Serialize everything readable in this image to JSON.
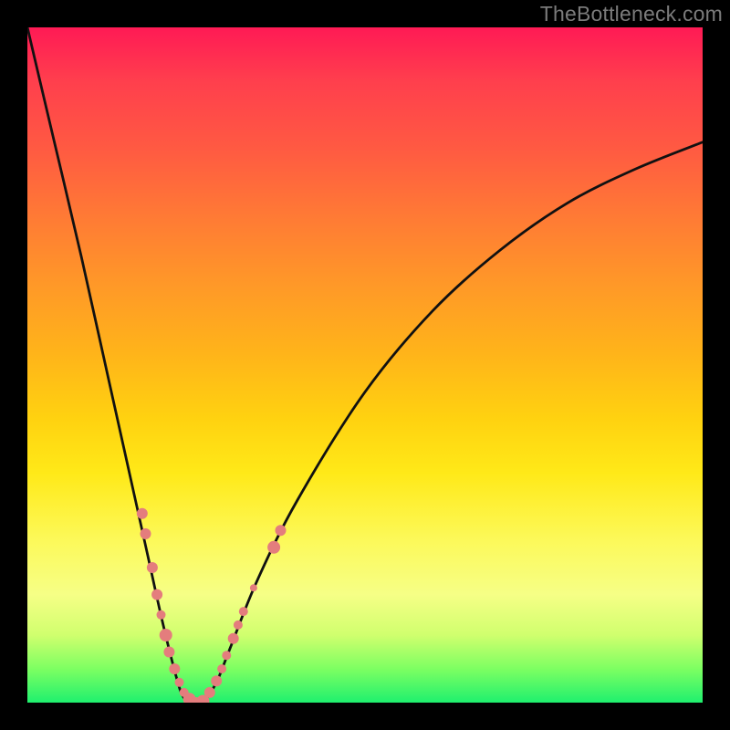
{
  "watermark": "TheBottleneck.com",
  "colors": {
    "background": "#000000",
    "gradient_top": "#ff1a55",
    "gradient_bottom": "#1ff06e",
    "curve": "#111111",
    "markers": "#e47d7d"
  },
  "chart_data": {
    "type": "line",
    "title": "",
    "xlabel": "",
    "ylabel": "",
    "xlim": [
      0,
      100
    ],
    "ylim": [
      0,
      100
    ],
    "series": [
      {
        "name": "curve",
        "x": [
          0,
          4,
          8,
          12,
          16,
          18,
          20,
          22,
          23,
          24,
          25,
          26,
          28,
          30,
          34,
          40,
          50,
          60,
          70,
          80,
          90,
          100
        ],
        "y": [
          100,
          83,
          66,
          48,
          30,
          21,
          12,
          4,
          1,
          0,
          0,
          0,
          3,
          8,
          18,
          30,
          46,
          58,
          67,
          74,
          79,
          83
        ]
      }
    ],
    "markers": [
      {
        "x": 17.0,
        "y": 28.0,
        "size": 12
      },
      {
        "x": 17.5,
        "y": 25.0,
        "size": 12
      },
      {
        "x": 18.5,
        "y": 20.0,
        "size": 12
      },
      {
        "x": 19.2,
        "y": 16.0,
        "size": 12
      },
      {
        "x": 19.8,
        "y": 13.0,
        "size": 10
      },
      {
        "x": 20.5,
        "y": 10.0,
        "size": 14
      },
      {
        "x": 21.0,
        "y": 7.5,
        "size": 12
      },
      {
        "x": 21.8,
        "y": 5.0,
        "size": 12
      },
      {
        "x": 22.5,
        "y": 3.0,
        "size": 10
      },
      {
        "x": 23.2,
        "y": 1.5,
        "size": 10
      },
      {
        "x": 24.0,
        "y": 0.5,
        "size": 14
      },
      {
        "x": 25.0,
        "y": 0.0,
        "size": 12
      },
      {
        "x": 26.0,
        "y": 0.2,
        "size": 14
      },
      {
        "x": 27.0,
        "y": 1.5,
        "size": 12
      },
      {
        "x": 28.0,
        "y": 3.2,
        "size": 12
      },
      {
        "x": 28.8,
        "y": 5.0,
        "size": 10
      },
      {
        "x": 29.5,
        "y": 7.0,
        "size": 10
      },
      {
        "x": 30.5,
        "y": 9.5,
        "size": 12
      },
      {
        "x": 31.2,
        "y": 11.5,
        "size": 10
      },
      {
        "x": 32.0,
        "y": 13.5,
        "size": 10
      },
      {
        "x": 33.5,
        "y": 17.0,
        "size": 8
      },
      {
        "x": 36.5,
        "y": 23.0,
        "size": 14
      },
      {
        "x": 37.5,
        "y": 25.5,
        "size": 12
      }
    ]
  }
}
